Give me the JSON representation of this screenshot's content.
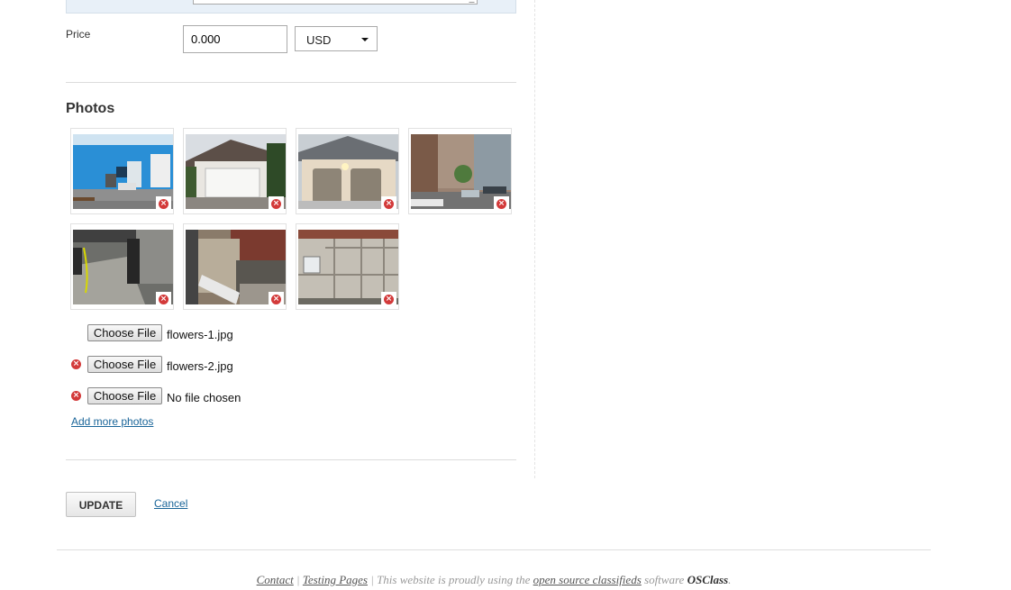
{
  "form": {
    "price_label": "Price",
    "price_value": "0.000",
    "currency": "USD"
  },
  "photos": {
    "title": "Photos",
    "thumbnails": [
      {
        "name": "blue-warehouse",
        "delete_icon": "remove-icon"
      },
      {
        "name": "white-garage",
        "delete_icon": "remove-icon"
      },
      {
        "name": "double-garage",
        "delete_icon": "remove-icon"
      },
      {
        "name": "street-view",
        "delete_icon": "remove-icon"
      },
      {
        "name": "foundation-repair",
        "delete_icon": "remove-icon"
      },
      {
        "name": "brick-wall",
        "delete_icon": "remove-icon"
      },
      {
        "name": "stone-wall",
        "delete_icon": "remove-icon"
      }
    ],
    "file_inputs": [
      {
        "button": "Choose File",
        "file": "flowers-1.jpg",
        "removable": false
      },
      {
        "button": "Choose File",
        "file": "flowers-2.jpg",
        "removable": true
      },
      {
        "button": "Choose File",
        "file": "No file chosen",
        "removable": true
      }
    ],
    "add_more": "Add more photos"
  },
  "actions": {
    "update": "UPDATE",
    "cancel": "Cancel"
  },
  "footer": {
    "contact": "Contact",
    "separator": "|",
    "testing_pages": "Testing Pages",
    "text_before": "This website is proudly using the",
    "link": "open source classifieds",
    "text_after": "software",
    "brand": "OSClass",
    "end": "."
  },
  "colors": {
    "link": "#1a6599",
    "delete": "#d33a3a"
  }
}
